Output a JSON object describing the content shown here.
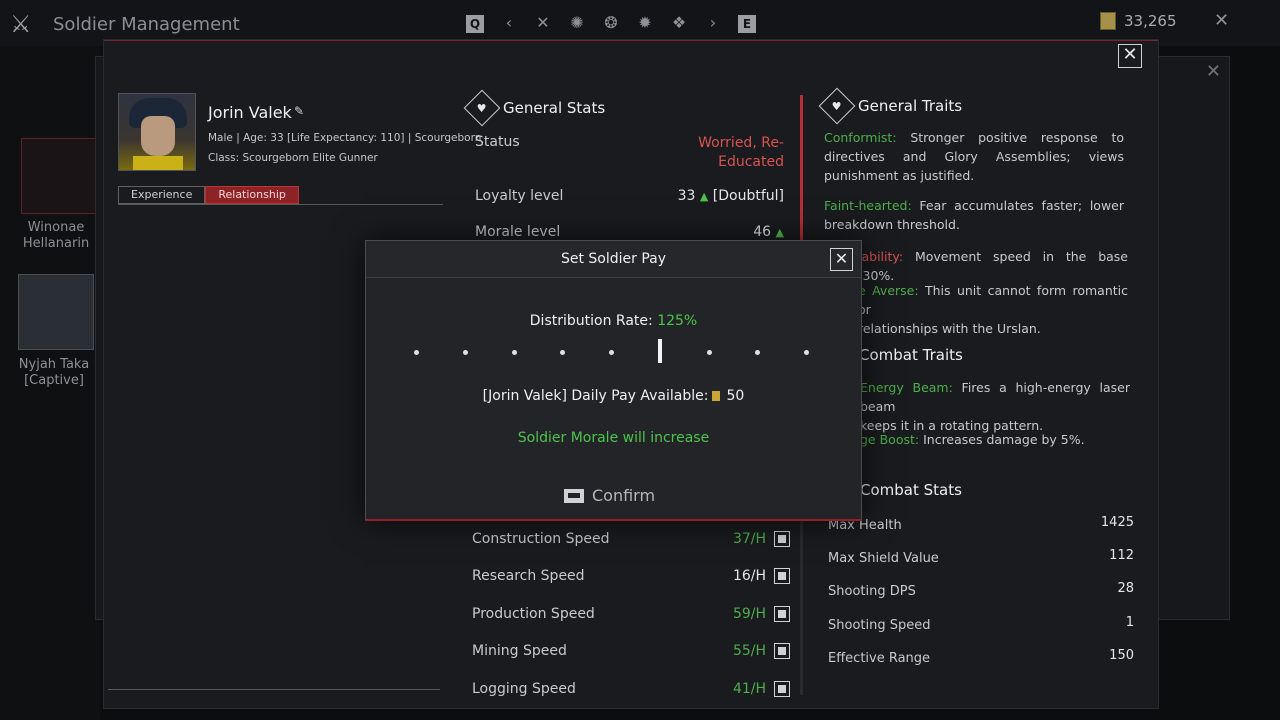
{
  "topbar": {
    "title": "Soldier Management",
    "tab_icons": [
      "q-key-icon",
      "chevron-left-icon",
      "crossed-swords-icon",
      "emblem-icon",
      "emblem-icon",
      "emblem-icon",
      "emblem-icon",
      "chevron-right-icon",
      "e-key-icon"
    ],
    "tab_q": "Q",
    "tab_e": "E",
    "currency": "33,265"
  },
  "roster": [
    {
      "name": "Winonae\nHellanarin"
    },
    {
      "name": "Nyjah Taka\n[Captive]"
    }
  ],
  "soldier": {
    "name": "Jorin Valek",
    "meta_line1": "Male | Age: 33 [Life Expectancy: 110] | Scourgeborn",
    "meta_line2": "Class: Scourgeborn Elite Gunner",
    "tabs": [
      "Experience",
      "Relationship"
    ],
    "active_tab": "Relationship"
  },
  "general_stats": {
    "title": "General Stats",
    "status_label": "Status",
    "status_value_1": "Worried, Re-",
    "status_value_2": "Educated",
    "loyalty_label": "Loyalty level",
    "loyalty_value": "33",
    "loyalty_tag": "[Doubtful]",
    "morale_label": "Morale level",
    "morale_value": "46"
  },
  "speeds": [
    {
      "label": "Construction Speed",
      "value": "37/H",
      "color": "#4cae4c"
    },
    {
      "label": "Research Speed",
      "value": "16/H",
      "color": "#e4e6e8"
    },
    {
      "label": "Production Speed",
      "value": "59/H",
      "color": "#4cae4c"
    },
    {
      "label": "Mining Speed",
      "value": "55/H",
      "color": "#4cae4c"
    },
    {
      "label": "Logging Speed",
      "value": "41/H",
      "color": "#4cae4c"
    }
  ],
  "general_traits": {
    "title": "General Traits",
    "t1_name": "Conformist:",
    "t1_desc": " Stronger positive response to directives and Glory Assemblies; views punishment as justified.",
    "t2_name": "Faint-hearted:",
    "t2_desc": " Fear accumulates faster; lower breakdown threshold.",
    "t3_name": "iability:",
    "t3_desc": " Movement speed in the base -30%.",
    "t4_name": "e Averse:",
    "t4_desc": " This unit cannot form romantic or",
    "t4_desc2": "relationships with the Urslan."
  },
  "combat_traits": {
    "title": "Combat Traits",
    "t1_name": "Energy Beam:",
    "t1_desc": " Fires a high-energy laser beam",
    "t1_desc2": "keeps it in a rotating pattern.",
    "t2_name": "ge Boost:",
    "t2_desc": " Increases damage by 5%."
  },
  "combat_stats": {
    "title": "Combat Stats",
    "rows": [
      {
        "label": "Max Health",
        "value": "1425"
      },
      {
        "label": "Max Shield Value",
        "value": "112"
      },
      {
        "label": "Shooting DPS",
        "value": "28"
      },
      {
        "label": "Shooting Speed",
        "value": "1"
      },
      {
        "label": "Effective Range",
        "value": "150"
      }
    ]
  },
  "modal": {
    "title": "Set Soldier Pay",
    "rate_label": "Distribution Rate:",
    "rate_value": "125%",
    "slider_steps": 9,
    "slider_selected_index": 5,
    "pay_label": "[Jorin Valek] Daily Pay Available:",
    "pay_value": "50",
    "morale_msg": "Soldier Morale will increase",
    "confirm_label": "Confirm"
  }
}
